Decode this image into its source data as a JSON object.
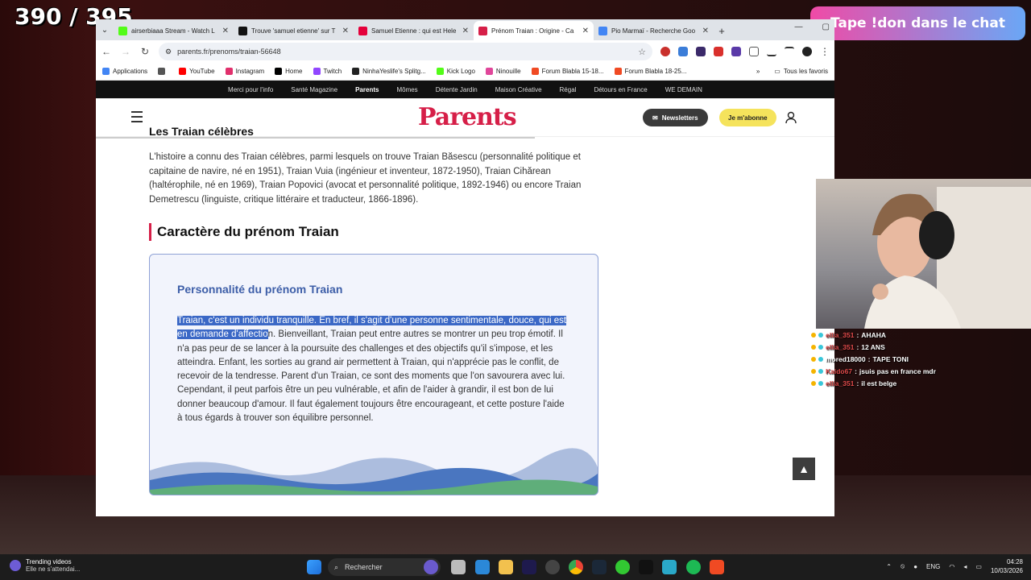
{
  "overlay": {
    "counter": "390 / 395",
    "donate_text": "Tape !don dans le chat"
  },
  "colors": {
    "accent": "#d61f48",
    "card_title": "#3d5ea8",
    "highlight": "#3b68c6",
    "subscribe_yellow": "#f5e35c"
  },
  "browser": {
    "tabs": [
      {
        "label": "airserbiaaa Stream - Watch L",
        "icon": "kick-icon",
        "active": false
      },
      {
        "label": "Trouve 'samuel etienne' sur T",
        "icon": "tiktok-icon",
        "active": false
      },
      {
        "label": "Samuel Etienne : qui est Hele",
        "icon": "voici-icon",
        "active": false
      },
      {
        "label": "Prénom Traian : Origine - Ca",
        "icon": "parents-icon",
        "active": true
      },
      {
        "label": "Pio Marmaï - Recherche Goo",
        "icon": "google-icon",
        "active": false
      }
    ],
    "url": "parents.fr/prenoms/traian-56648",
    "bookmarks": [
      {
        "label": "Applications",
        "icon": "apps-icon"
      },
      {
        "label": "",
        "icon": "grid-icon"
      },
      {
        "label": "YouTube",
        "icon": "youtube-icon"
      },
      {
        "label": "Instagram",
        "icon": "instagram-icon"
      },
      {
        "label": "Home",
        "icon": "x-icon"
      },
      {
        "label": "Twitch",
        "icon": "twitch-icon"
      },
      {
        "label": "NinhaYeslife's Splitg...",
        "icon": "splitgate-icon"
      },
      {
        "label": "Kick Logo",
        "icon": "kick-icon"
      },
      {
        "label": "Ninouille",
        "icon": "ninouille-icon"
      },
      {
        "label": "Forum Blabla 15-18...",
        "icon": "jv-icon"
      },
      {
        "label": "Forum Blabla 18-25...",
        "icon": "jv-icon"
      }
    ],
    "all_bookmarks": "Tous les favoris"
  },
  "site": {
    "topnav": [
      "Merci pour l'info",
      "Santé Magazine",
      "Parents",
      "Mômes",
      "Détente Jardin",
      "Maison Créative",
      "Régal",
      "Détours en France",
      "WE DEMAIN"
    ],
    "topnav_active": "Parents",
    "logo": "Parents",
    "newsletters": "Newsletters",
    "subscribe": "Je m'abonne"
  },
  "article": {
    "celebrities_title": "Les Traian célèbres",
    "celebrities_text": "L'histoire a connu des Traian célèbres, parmi lesquels on trouve Traian Băsescu (personnalité politique et capitaine de navire, né en 1951), Traian Vuia (ingénieur et inventeur, 1872-1950), Traian Cihărean (haltérophile, né en 1969), Traian Popovici (avocat et personnalité politique, 1892-1946) ou encore Traian Demetrescu (linguiste, critique littéraire et traducteur, 1866-1896).",
    "character_title": "Caractère du prénom Traian",
    "card_title": "Personnalité du prénom Traian",
    "card_text_highlighted": "Traian, c'est un individu tranquille. En bref, il s'agit d'une personne sentimentale, douce, qui est en demande d'affectio",
    "card_text_rest": "n. Bienveillant, Traian peut entre autres se montrer un peu trop émotif. Il n'a pas peur de se lancer à la poursuite des challenges et des objectifs qu'il s'impose, et les atteindra. Enfant, les sorties au grand air permettent à Traian, qui n'apprécie pas le conflit, de recevoir de la tendresse. Parent d'un Traian, ce sont des moments que l'on savourera avec lui. Cependant, il peut parfois être un peu vulnérable, et afin de l'aider à grandir, il est bon de lui donner beaucoup d'amour. Il faut également toujours être encourageant, et cette posture l'aide à tous égards à trouver son équilibre personnel."
  },
  "chat": [
    {
      "user": "ellia_351",
      "message": "AHAHA",
      "color": "#e04a4a"
    },
    {
      "user": "ellia_351",
      "message": "12 ANS",
      "color": "#e04a4a"
    },
    {
      "user": "mored18000",
      "message": "TAPE TONI",
      "color": "#ffffff"
    },
    {
      "user": "Kaido67",
      "message": "jsuis pas en france mdr",
      "color": "#e04a4a"
    },
    {
      "user": "ellia_351",
      "message": "il est belge",
      "color": "#e04a4a"
    }
  ],
  "taskbar": {
    "trending_title": "Trending videos",
    "trending_sub": "Elle ne s'attendai...",
    "search_placeholder": "Rechercher",
    "lang": "ENG",
    "time": "04:28",
    "date": "10/03/2026"
  }
}
